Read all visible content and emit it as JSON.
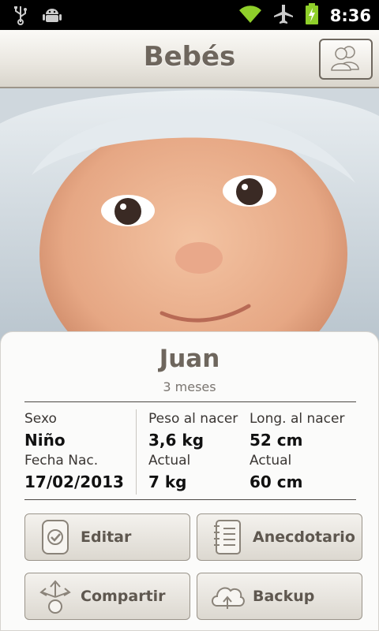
{
  "status_bar": {
    "time": "8:36",
    "icons": [
      "usb-icon",
      "android-debug-icon",
      "wifi-icon",
      "airplane-mode-icon",
      "battery-charging-icon"
    ]
  },
  "action_bar": {
    "title": "Bebés",
    "profiles_icon": "people-icon"
  },
  "photo": {
    "alt": "baby-photo"
  },
  "baby": {
    "name": "Juan",
    "age": "3 meses"
  },
  "details": {
    "sex_label": "Sexo",
    "sex_value": "Niño",
    "birth_label": "Fecha Nac.",
    "birth_value": "17/02/2013",
    "weight_birth_label": "Peso al nacer",
    "weight_birth_value": "3,6 kg",
    "weight_now_label": "Actual",
    "weight_now_value": "7 kg",
    "length_birth_label": "Long. al nacer",
    "length_birth_value": "52 cm",
    "length_now_label": "Actual",
    "length_now_value": "60 cm"
  },
  "buttons": {
    "edit": "Editar",
    "anecdotes": "Anecdotario",
    "share": "Compartir",
    "backup": "Backup"
  },
  "colors": {
    "title": "#6e665d",
    "button_text": "#5e574f",
    "status_icons": "#8fcf2a"
  }
}
